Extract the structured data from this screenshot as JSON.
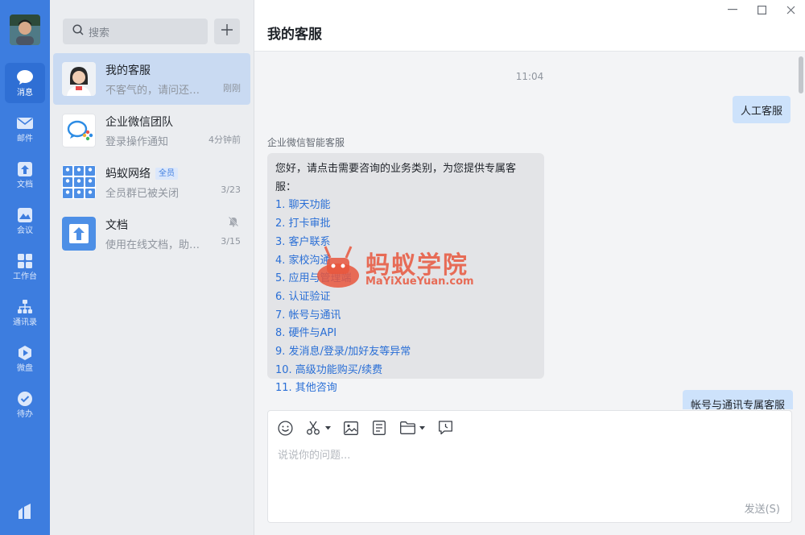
{
  "nav": {
    "items": [
      {
        "label": "消息",
        "icon": "chat-bubble-icon"
      },
      {
        "label": "邮件",
        "icon": "mail-icon"
      },
      {
        "label": "文档",
        "icon": "document-icon"
      },
      {
        "label": "会议",
        "icon": "meeting-icon"
      },
      {
        "label": "工作台",
        "icon": "workbench-icon"
      },
      {
        "label": "通讯录",
        "icon": "contacts-icon"
      },
      {
        "label": "微盘",
        "icon": "cloud-drive-icon"
      },
      {
        "label": "待办",
        "icon": "todo-icon"
      }
    ],
    "accent": "#3d7ddf"
  },
  "search": {
    "placeholder": "搜索"
  },
  "conversations": [
    {
      "name": "我的客服",
      "preview": "不客气的，请问还有其...",
      "time": "刚刚"
    },
    {
      "name": "企业微信团队",
      "preview": "登录操作通知",
      "time": "4分钟前"
    },
    {
      "name": "蚂蚁网络",
      "badge": "全员",
      "preview": "全员群已被关闭",
      "time": "3/23"
    },
    {
      "name": "文档",
      "preview": "使用在线文档，助力疫...",
      "time": "3/15"
    }
  ],
  "chat": {
    "title": "我的客服",
    "timestamp": "11:04",
    "outgoing_1": "人工客服",
    "sender": "企业微信智能客服",
    "intro": "您好，请点击需要咨询的业务类别，为您提供专属客服：",
    "options": [
      "1. 聊天功能",
      "2. 打卡审批",
      "3. 客户联系",
      "4. 家校沟通",
      "5. 应用与管理端",
      "6. 认证验证",
      "7. 帐号与通讯",
      "8. 硬件与API",
      "9. 发消息/登录/加好友等异常",
      "10. 高级功能购买/续费",
      "11. 其他咨询"
    ],
    "outgoing_2": "帐号与通讯专属客服"
  },
  "watermark": {
    "title": "蚂蚁学院",
    "subtitle": "MaYiXueYuan.com"
  },
  "composer": {
    "placeholder": "说说你的问题...",
    "send_label": "发送(S)",
    "tools": [
      "emoji-icon",
      "scissors-icon",
      "image-icon",
      "note-icon",
      "folder-icon",
      "history-icon"
    ]
  }
}
